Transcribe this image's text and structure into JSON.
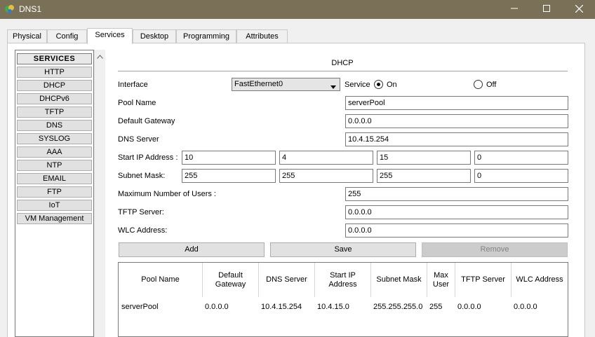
{
  "window": {
    "title": "DNS1"
  },
  "tabs": [
    {
      "label": "Physical"
    },
    {
      "label": "Config"
    },
    {
      "label": "Services"
    },
    {
      "label": "Desktop"
    },
    {
      "label": "Programming"
    },
    {
      "label": "Attributes"
    }
  ],
  "sidebar": {
    "header": "SERVICES",
    "items": [
      "HTTP",
      "DHCP",
      "DHCPv6",
      "TFTP",
      "DNS",
      "SYSLOG",
      "AAA",
      "NTP",
      "EMAIL",
      "FTP",
      "IoT",
      "VM Management"
    ]
  },
  "dhcp": {
    "title": "DHCP",
    "interface_label": "Interface",
    "interface_value": "FastEthernet0",
    "service_label": "Service",
    "on_label": "On",
    "off_label": "Off",
    "service_state": "On",
    "pool_name_label": "Pool Name",
    "pool_name": "serverPool",
    "gateway_label": "Default Gateway",
    "gateway": "0.0.0.0",
    "dns_label": "DNS Server",
    "dns": "10.4.15.254",
    "start_ip_label": "Start IP Address :",
    "start_ip": [
      "10",
      "4",
      "15",
      "0"
    ],
    "mask_label": "Subnet Mask:",
    "mask": [
      "255",
      "255",
      "255",
      "0"
    ],
    "max_users_label": "Maximum Number of Users :",
    "max_users": "255",
    "tftp_label": "TFTP Server:",
    "tftp": "0.0.0.0",
    "wlc_label": "WLC Address:",
    "wlc": "0.0.0.0"
  },
  "actions": {
    "add": "Add",
    "save": "Save",
    "remove": "Remove"
  },
  "table": {
    "columns": [
      "Pool Name",
      "Default Gateway",
      "DNS Server",
      "Start IP Address",
      "Subnet Mask",
      "Max User",
      "TFTP Server",
      "WLC Address"
    ],
    "rows": [
      [
        "serverPool",
        "0.0.0.0",
        "10.4.15.254",
        "10.4.15.0",
        "255.255.255.0",
        "255",
        "0.0.0.0",
        "0.0.0.0"
      ]
    ]
  },
  "colors": {
    "titlebar": "#7a7058",
    "disabled_button": "#cccccc"
  },
  "icons": [
    "app-icon",
    "minimize-icon",
    "maximize-icon",
    "close-icon",
    "chevron-down-icon",
    "scroll-up-icon"
  ]
}
